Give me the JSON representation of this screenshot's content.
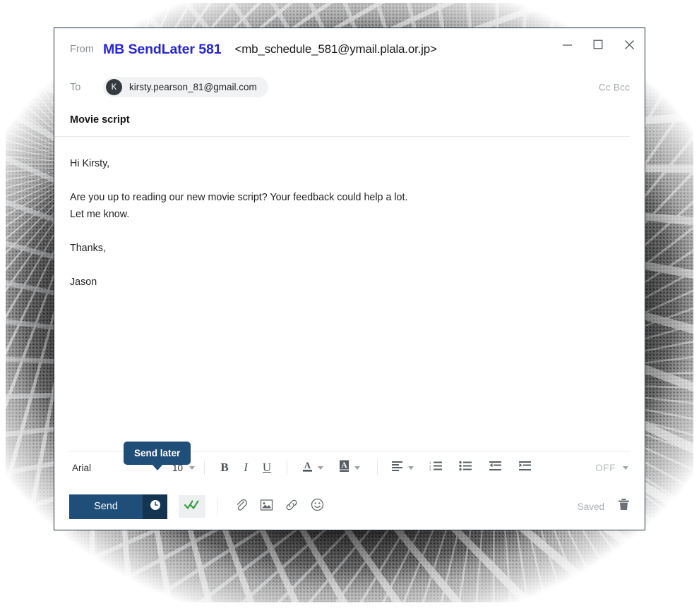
{
  "window": {
    "controls": {
      "minimize": "minimize-icon",
      "maximize": "maximize-icon",
      "close": "close-icon"
    }
  },
  "compose": {
    "from": {
      "label": "From",
      "display_name": "MB SendLater 581",
      "address": "<mb_schedule_581@ymail.plala.or.jp>"
    },
    "to": {
      "label": "To",
      "avatar_initial": "K",
      "email": "kirsty.pearson_81@gmail.com",
      "cc_bcc": "Cc Bcc"
    },
    "subject": "Movie script",
    "body": [
      "Hi Kirsty,",
      "",
      "Are you up to reading our new movie script? Your feedback could help a lot.",
      "Let me know.",
      "",
      "Thanks,",
      "",
      "Jason"
    ]
  },
  "format_toolbar": {
    "font_family": "Arial",
    "font_size": "10",
    "bold": "B",
    "italic": "I",
    "underline": "U",
    "text_color": "A",
    "highlight_color": "A",
    "align": "align-left-icon",
    "numbered_list": "numbered-list-icon",
    "bullet_list": "bullet-list-icon",
    "outdent": "outdent-icon",
    "indent": "indent-icon",
    "off_label": "OFF"
  },
  "action_bar": {
    "send_label": "Send",
    "send_later_icon": "clock-icon",
    "tooltip": "Send later",
    "read_receipt_icon": "double-check-icon",
    "attach_icon": "paperclip-icon",
    "image_icon": "image-icon",
    "link_icon": "link-icon",
    "emoji_icon": "smiley-icon",
    "saved_label": "Saved",
    "delete_icon": "trash-icon"
  },
  "colors": {
    "accent": "#1f4e79",
    "accent_dark": "#143551",
    "from_name": "#2726d6",
    "check_green": "#2f9e3f",
    "avatar_bg": "#343a40"
  }
}
